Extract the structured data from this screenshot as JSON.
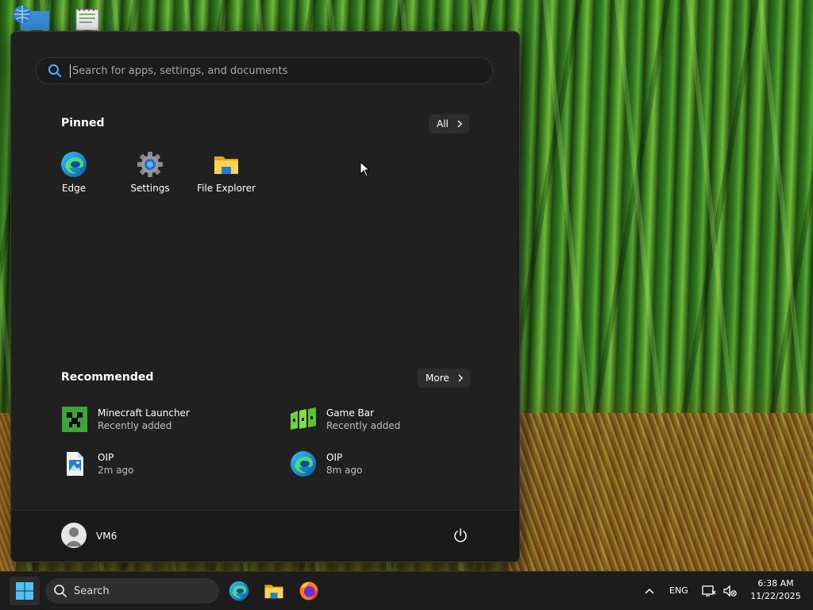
{
  "start_menu": {
    "search": {
      "placeholder": "Search for apps, settings, and documents"
    },
    "pinned": {
      "title": "Pinned",
      "all_button": "All",
      "items": [
        {
          "label": "Edge",
          "icon": "edge-icon"
        },
        {
          "label": "Settings",
          "icon": "settings-gear-icon"
        },
        {
          "label": "File Explorer",
          "icon": "folder-icon"
        }
      ]
    },
    "recommended": {
      "title": "Recommended",
      "more_button": "More",
      "items": [
        {
          "name": "Minecraft Launcher",
          "sub": "Recently added",
          "icon": "minecraft-icon"
        },
        {
          "name": "Game Bar",
          "sub": "Recently added",
          "icon": "game-bar-icon"
        },
        {
          "name": "OIP",
          "sub": "2m ago",
          "icon": "image-file-icon"
        },
        {
          "name": "OIP",
          "sub": "8m ago",
          "icon": "edge-icon"
        }
      ]
    },
    "user": {
      "name": "VM6"
    }
  },
  "taskbar": {
    "search_label": "Search",
    "apps": [
      "edge-icon",
      "file-explorer-icon",
      "firefox-icon"
    ],
    "tray": {
      "language": "ENG",
      "time": "6:38 AM",
      "date": "11/22/2025"
    }
  },
  "colors": {
    "menu_bg": "#202020",
    "taskbar_bg": "#1c1c1c",
    "accent": "#0078d4"
  }
}
